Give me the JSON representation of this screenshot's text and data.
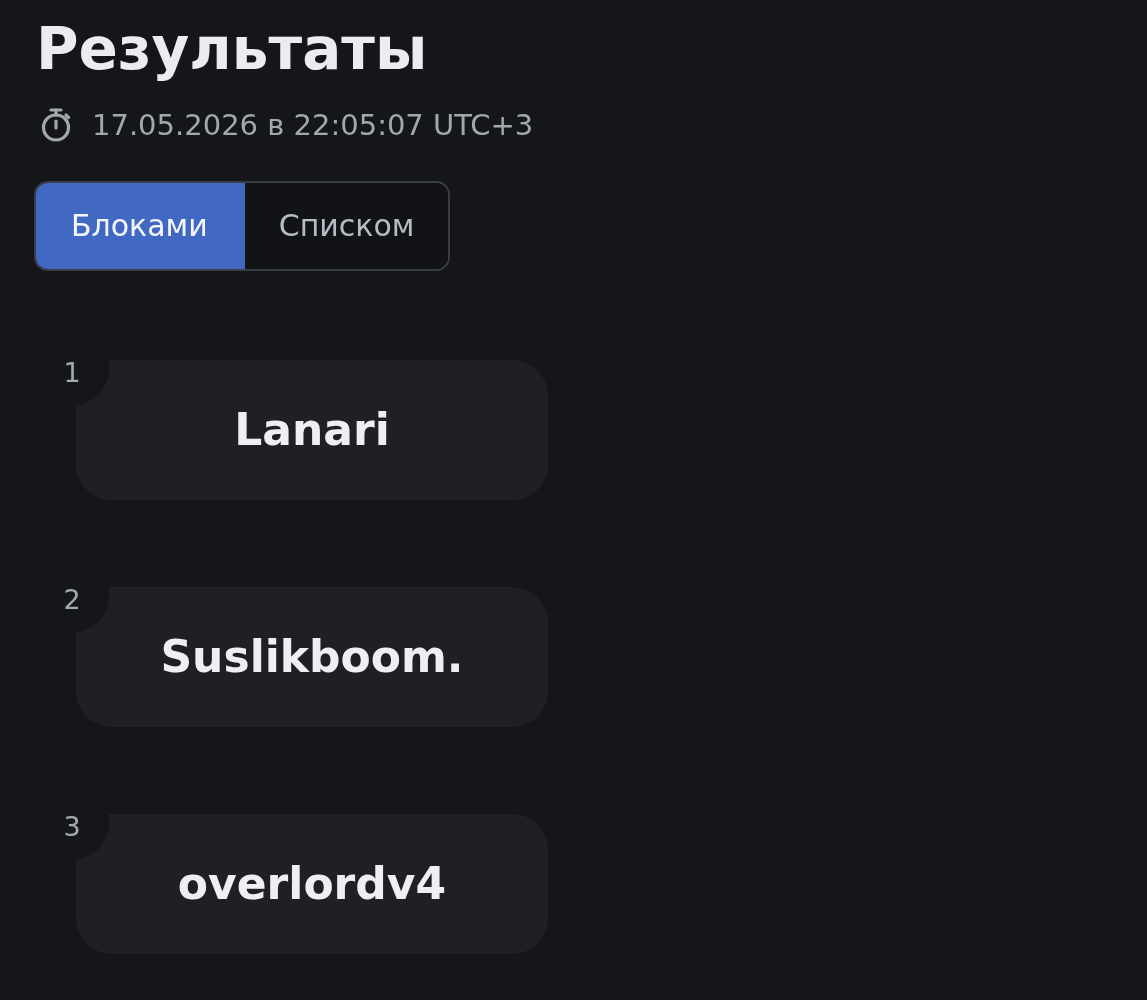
{
  "title": "Результаты",
  "timestamp": "17.05.2026 в 22:05:07 UTC+3",
  "view_tabs": [
    {
      "label": "Блоками",
      "selected": true
    },
    {
      "label": "Списком",
      "selected": false
    }
  ],
  "results": [
    {
      "rank": "1",
      "name": "Lanari"
    },
    {
      "rank": "2",
      "name": "Suslikboom."
    },
    {
      "rank": "3",
      "name": "overlordv4"
    }
  ]
}
